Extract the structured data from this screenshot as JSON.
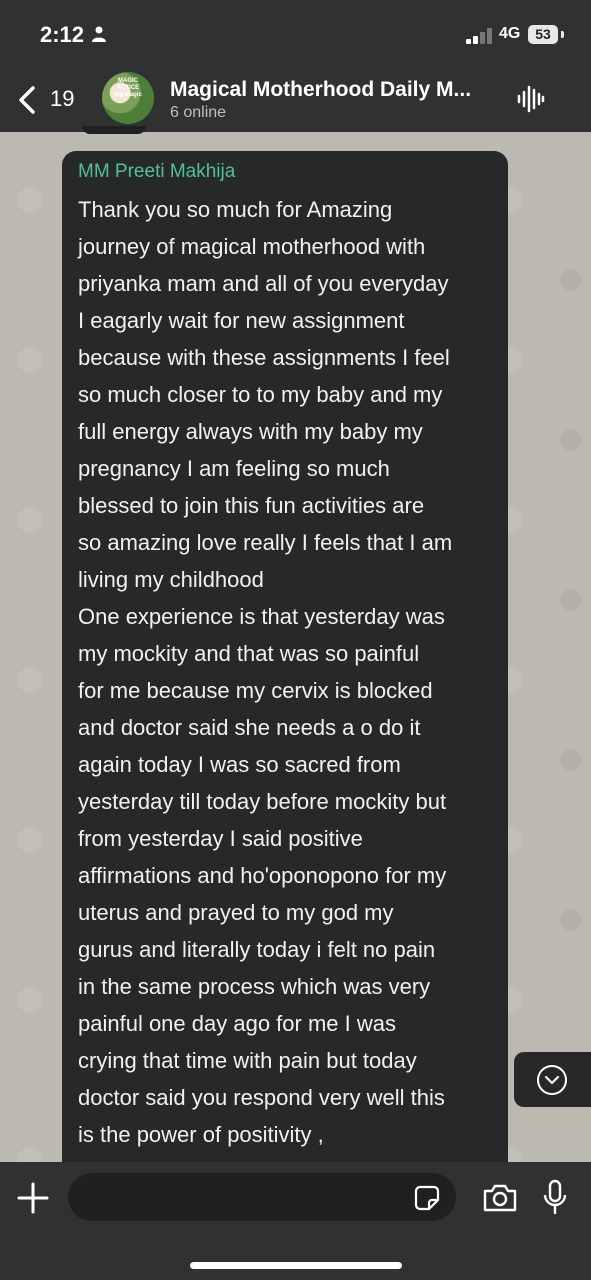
{
  "status_bar": {
    "time": "2:12",
    "network": "4G",
    "battery": "53"
  },
  "header": {
    "back_count": "19",
    "avatar_text": "MAGIC\nACTICE\ning Magic",
    "group_name": "Magical Motherhood Daily M...",
    "online": "6 online"
  },
  "message": {
    "sender": "MM Preeti Makhija",
    "sender_color": "#53bf9d",
    "text": "Thank you so much for Amazing\njourney of magical motherhood with\npriyanka mam and all of you everyday\nI eagarly wait for new assignment\nbecause with these assignments I feel\nso much closer to to my baby and my\nfull energy always with my baby my\npregnancy I am feeling so much\nblessed to join this fun activities are\nso amazing love really I feels that I am\nliving my childhood\nOne experience is that yesterday was\nmy mockity and that was so painful\nfor me because my cervix is blocked\nand doctor said she needs a o do it\nagain today I was so sacred from\nyesterday till today before mockity but\nfrom yesterday I said positive\naffirmations and ho'oponopono for my\nuterus and prayed to my god my\ngurus and literally today i felt no pain\nin the same process which was very\npainful one day ago for me I was\ncrying that time with pain but today\ndoctor said you respond very well this\nis the power of positivity ,"
  },
  "icons": {
    "back": "chevron-left-icon",
    "voice": "audio-waveform-icon",
    "scroll_down": "chevron-down-circle-icon",
    "attach": "plus-icon",
    "sticker": "sticker-icon",
    "camera": "camera-icon",
    "mic": "microphone-icon"
  },
  "composer": {
    "placeholder": ""
  }
}
